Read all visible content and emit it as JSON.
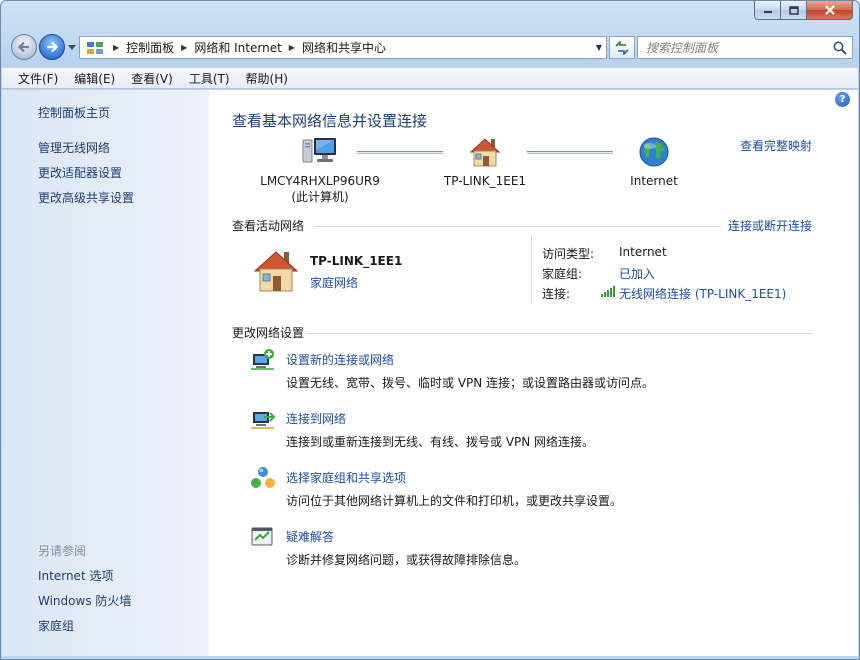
{
  "window": {
    "caption_buttons": [
      "minimize",
      "maximize",
      "close"
    ]
  },
  "address_bar": {
    "breadcrumbs": [
      "控制面板",
      "网络和 Internet",
      "网络和共享中心"
    ]
  },
  "search": {
    "placeholder": "搜索控制面板"
  },
  "menu": [
    "文件(F)",
    "编辑(E)",
    "查看(V)",
    "工具(T)",
    "帮助(H)"
  ],
  "sidebar": {
    "items": [
      "控制面板主页",
      "管理无线网络",
      "更改适配器设置",
      "更改高级共享设置"
    ],
    "see_also_title": "另请参阅",
    "see_also": [
      "Internet 选项",
      "Windows 防火墙",
      "家庭组"
    ]
  },
  "main": {
    "title": "查看基本网络信息并设置连接",
    "full_map_link": "查看完整映射",
    "map_nodes": [
      {
        "label": "LMCY4RHXLP96UR9",
        "sublabel": "(此计算机)",
        "icon": "computer-icon"
      },
      {
        "label": "TP-LINK_1EE1",
        "icon": "home-network-icon"
      },
      {
        "label": "Internet",
        "icon": "globe-icon"
      }
    ],
    "active_networks": {
      "title": "查看活动网络",
      "connect_link": "连接或断开连接",
      "network_name": "TP-LINK_1EE1",
      "network_type": "家庭网络",
      "access_type_label": "访问类型:",
      "access_type_value": "Internet",
      "homegroup_label": "家庭组:",
      "homegroup_value": "已加入",
      "connection_label": "连接:",
      "connection_value": "无线网络连接 (TP-LINK_1EE1)"
    },
    "change_settings": {
      "title": "更改网络设置",
      "tasks": [
        {
          "link": "设置新的连接或网络",
          "desc": "设置无线、宽带、拨号、临时或 VPN 连接；或设置路由器或访问点。",
          "icon": "new-connection-icon"
        },
        {
          "link": "连接到网络",
          "desc": "连接到或重新连接到无线、有线、拨号或 VPN 网络连接。",
          "icon": "connect-network-icon"
        },
        {
          "link": "选择家庭组和共享选项",
          "desc": "访问位于其他网络计算机上的文件和打印机，或更改共享设置。",
          "icon": "homegroup-icon"
        },
        {
          "link": "疑难解答",
          "desc": "诊断并修复网络问题，或获得故障排除信息。",
          "icon": "troubleshoot-icon"
        }
      ]
    }
  },
  "help_label": "?"
}
